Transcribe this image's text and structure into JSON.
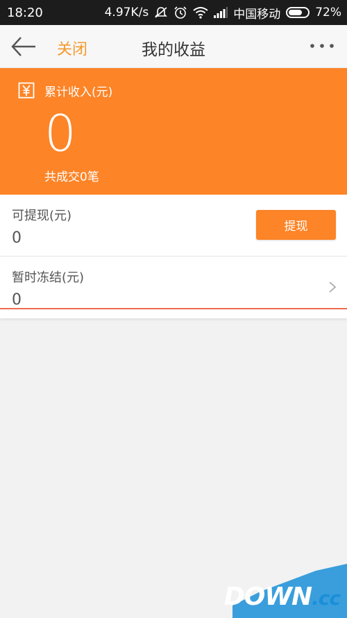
{
  "status_bar": {
    "time": "18:20",
    "speed": "4.97K/s",
    "carrier": "中国移动",
    "battery_pct": "72%",
    "battery_level": 0.72
  },
  "nav": {
    "close_label": "关闭",
    "title": "我的收益"
  },
  "income": {
    "label": "累计收入(元)",
    "amount": "0",
    "deals": "共成交0笔"
  },
  "withdrawable": {
    "label": "可提现(元)",
    "value": "0",
    "button_label": "提现"
  },
  "frozen": {
    "label": "暂时冻结(元)",
    "value": "0"
  },
  "watermark": {
    "text": "DOWN",
    "suffix": ".cc"
  },
  "colors": {
    "accent": "#fd8427",
    "close_text": "#f39a2b",
    "underline": "#ee6b4d"
  }
}
